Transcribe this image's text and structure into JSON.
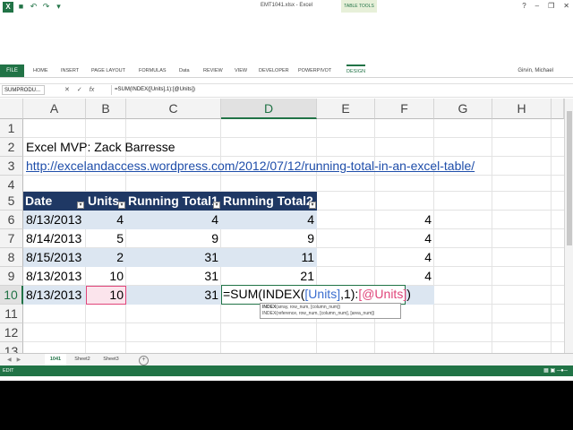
{
  "window": {
    "title": "EMT1041.xlsx - Excel",
    "contextual_tab_group": "TABLE TOOLS",
    "user": "Girvin, Michael"
  },
  "ribbon": {
    "file": "FILE",
    "tabs": [
      "HOME",
      "INSERT",
      "PAGE LAYOUT",
      "FORMULAS",
      "Data",
      "REVIEW",
      "VIEW",
      "DEVELOPER",
      "POWERPIVOT",
      "DESIGN"
    ]
  },
  "formula_bar": {
    "name_box": "SUMPRODU...",
    "formula": "=SUM(INDEX([Units],1):[@Units])"
  },
  "columns": [
    "A",
    "B",
    "C",
    "D",
    "E",
    "F",
    "G",
    "H"
  ],
  "rows": [
    "1",
    "2",
    "3",
    "4",
    "5",
    "6",
    "7",
    "8",
    "9",
    "10",
    "11",
    "12",
    "13"
  ],
  "cells": {
    "a2": "Excel MVP: Zack Barresse",
    "a3": "http://excelandaccess.wordpress.com/2012/07/12/running-total-in-an-excel-table/"
  },
  "table": {
    "headers": [
      "Date",
      "Units",
      "Running Total1",
      "Running Total2"
    ],
    "rows": [
      [
        "8/13/2013",
        "4",
        "4",
        "4"
      ],
      [
        "8/14/2013",
        "5",
        "9",
        "9"
      ],
      [
        "8/15/2013",
        "2",
        "31",
        "11"
      ],
      [
        "8/13/2013",
        "10",
        "31",
        "21"
      ],
      [
        "8/13/2013",
        "10",
        "31",
        ""
      ]
    ],
    "f_values": [
      "4",
      "4",
      "4",
      "4"
    ]
  },
  "edit": {
    "prefix": "=SUM(INDEX(",
    "ref1": "[Units]",
    "mid": ",1):",
    "ref2": "[@Units]",
    "suffix": ")"
  },
  "tooltip": {
    "line1_fn": "INDEX",
    "line1_args": "(array, row_num, [column_num])",
    "line2_fn": "INDEX",
    "line2_args": "(reference, row_num, [column_num], [area_num])"
  },
  "sheets": [
    "1041",
    "Sheet2",
    "Sheet3"
  ],
  "status": {
    "mode": "EDIT"
  },
  "colors": {
    "excel_green": "#217346",
    "table_header": "#1f3864",
    "band": "#dce6f1"
  }
}
